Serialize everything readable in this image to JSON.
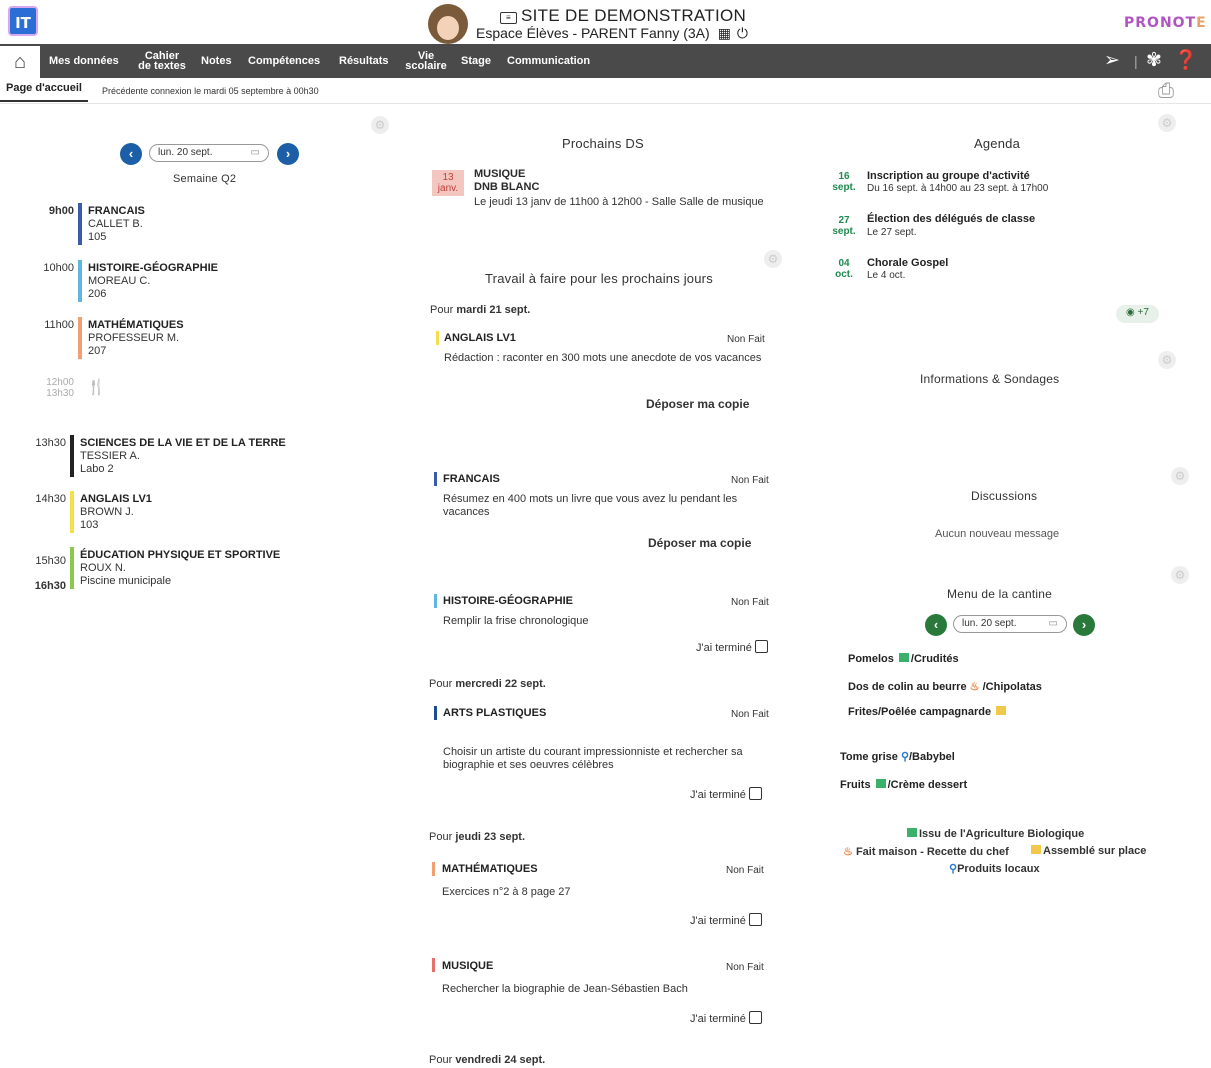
{
  "header": {
    "logo": "IT",
    "site_title": "SITE DE DEMONSTRATION",
    "site_subtitle": "Espace Élèves - PARENT Fanny (3A)",
    "brand_main": "PRONOT",
    "brand_tail": "E"
  },
  "nav": {
    "home": "⌂",
    "items": [
      {
        "label": "Mes données"
      },
      {
        "label": "Cahier\nde textes"
      },
      {
        "label": "Notes"
      },
      {
        "label": "Compétences"
      },
      {
        "label": "Résultats"
      },
      {
        "label": "Vie\nscolaire"
      },
      {
        "label": "Stage"
      },
      {
        "label": "Communication"
      }
    ],
    "right_icons": [
      "send-icon",
      "butterfly-icon",
      "help-icon"
    ]
  },
  "subbar": {
    "tab": "Page d'accueil",
    "last_connection": "Précédente connexion le mardi 05 septembre à 00h30"
  },
  "timetable": {
    "date": "lun. 20 sept.",
    "week": "Semaine Q2",
    "lessons": [
      {
        "start": "9h00",
        "subject": "FRANCAIS",
        "teacher": "CALLET B.",
        "room": "105",
        "color": "#3b5ba8"
      },
      {
        "start": "10h00",
        "subject": "HISTOIRE-GÉOGRAPHIE",
        "teacher": "MOREAU C.",
        "room": "206",
        "color": "#5fb7e0"
      },
      {
        "start": "11h00",
        "subject": "MATHÉMATIQUES",
        "teacher": "PROFESSEUR M.",
        "room": "207",
        "color": "#f0a070"
      },
      {
        "start": "13h30",
        "subject": "SCIENCES DE LA VIE ET DE LA TERRE",
        "teacher": "TESSIER A.",
        "room": "Labo 2",
        "color": "#222222"
      },
      {
        "start": "14h30",
        "subject": "ANGLAIS LV1",
        "teacher": "BROWN J.",
        "room": "103",
        "color": "#f4e04a"
      },
      {
        "start": "15h30",
        "end": "16h30",
        "subject": "ÉDUCATION PHYSIQUE ET SPORTIVE",
        "teacher": "ROUX N.",
        "room": "Piscine municipale",
        "color": "#8cc84b"
      }
    ],
    "lunch": {
      "start": "12h00",
      "end": "13h30"
    }
  },
  "exams": {
    "title": "Prochains DS",
    "date_day": "13",
    "date_month": "janv.",
    "subject": "MUSIQUE",
    "name": "DNB BLANC",
    "detail": "Le jeudi 13 janv de 11h00 à 12h00  - Salle Salle de musique"
  },
  "homework": {
    "title": "Travail à faire pour les prochains jours",
    "status_label": "Non Fait",
    "deposit_label": "Déposer ma copie",
    "done_label": "J'ai terminé",
    "prefix": "Pour",
    "groups": [
      {
        "day": "mardi 21 sept."
      },
      {
        "day": "mercredi 22 sept."
      },
      {
        "day": "jeudi 23 sept."
      },
      {
        "day": "vendredi 24 sept."
      }
    ],
    "items": [
      {
        "subject": "ANGLAIS LV1",
        "text": "Rédaction : raconter en 300 mots une anecdote de vos vacances",
        "color": "#f4e04a"
      },
      {
        "subject": "FRANCAIS",
        "text": "Résumez en 400 mots un livre que vous avez lu pendant les vacances",
        "color": "#3b5ba8"
      },
      {
        "subject": "HISTOIRE-GÉOGRAPHIE",
        "text": "Remplir la frise chronologique",
        "color": "#5fb7e0"
      },
      {
        "subject": "ARTS PLASTIQUES",
        "text": "Choisir un artiste du courant impressionniste et rechercher sa biographie et ses oeuvres célèbres",
        "color": "#1c4f8a"
      },
      {
        "subject": "MATHÉMATIQUES",
        "text": "Exercices n°2 à 8 page 27",
        "color": "#f0a070"
      },
      {
        "subject": "MUSIQUE",
        "text": "Rechercher la biographie de Jean-Sébastien Bach",
        "color": "#e8706a"
      }
    ]
  },
  "agenda": {
    "title": "Agenda",
    "events": [
      {
        "day": "16",
        "month": "sept.",
        "title": "Inscription au groupe d'activité",
        "detail": "Du 16 sept. à 14h00 au 23 sept. à 17h00"
      },
      {
        "day": "27",
        "month": "sept.",
        "title": "Élection des délégués de classe",
        "detail": "Le 27 sept."
      },
      {
        "day": "04",
        "month": "oct.",
        "title": "Chorale Gospel",
        "detail": "Le 4 oct."
      }
    ],
    "more": "+7"
  },
  "info": {
    "title": "Informations & Sondages"
  },
  "discussions": {
    "title": "Discussions",
    "empty": "Aucun nouveau message"
  },
  "canteen": {
    "title": "Menu de la cantine",
    "date": "lun. 20 sept.",
    "lines": [
      {
        "a": "Pomelos",
        "b": "/Crudités"
      },
      {
        "a": "Dos de colin au beurre",
        "b": "/Chipolatas"
      },
      {
        "a": "Frites/Poêlée campagnarde",
        "b": ""
      },
      {
        "a": "Tome grise",
        "b": "/Babybel"
      },
      {
        "a": "Fruits",
        "b": "/Crème dessert"
      }
    ],
    "legend": {
      "bio": "Issu de l'Agriculture Biologique",
      "maison": "Fait maison - Recette du chef",
      "assemble": "Assemblé sur place",
      "local": "Produits locaux"
    }
  }
}
